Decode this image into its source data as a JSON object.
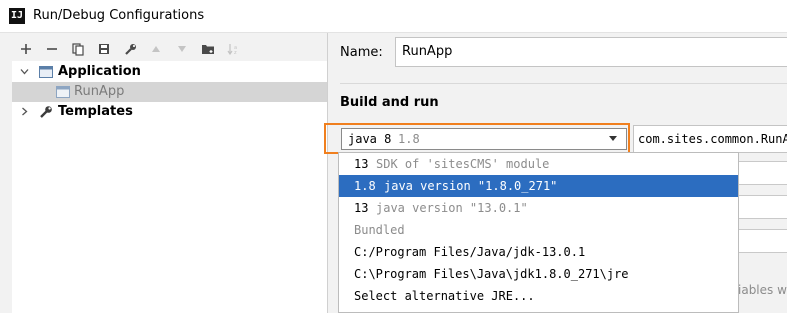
{
  "window": {
    "title": "Run/Debug Configurations",
    "app_icon_text": "IJ"
  },
  "toolbar": {
    "icons": [
      "plus-icon",
      "minus-icon",
      "copy-icon",
      "save-icon",
      "wrench-icon",
      "arrow-up-icon",
      "arrow-down-icon",
      "folder-icon",
      "sort-icon"
    ]
  },
  "tree": {
    "application_label": "Application",
    "runapp_label": "RunApp",
    "templates_label": "Templates"
  },
  "config": {
    "name_label": "Name:",
    "name_value": "RunApp",
    "build_run_label": "Build and run"
  },
  "jre_combo": {
    "primary": "java 8",
    "secondary": "1.8"
  },
  "main_class": {
    "value": "com.sites.common.RunApp"
  },
  "env_truncated": "iables w",
  "dropdown": {
    "items": [
      {
        "primary": "13",
        "secondary": "SDK of 'sitesCMS' module",
        "selected": false
      },
      {
        "primary": "1.8",
        "secondary": "java version \"1.8.0_271\"",
        "selected": true
      },
      {
        "primary": "13",
        "secondary": "java version \"13.0.1\"",
        "selected": false
      },
      {
        "primary": "Bundled",
        "secondary": "",
        "selected": false
      },
      {
        "primary": "C:/Program Files/Java/jdk-13.0.1",
        "secondary": "",
        "selected": false
      },
      {
        "primary": "C:\\Program Files\\Java\\jdk1.8.0_271\\jre",
        "secondary": "",
        "selected": false
      },
      {
        "primary": "Select alternative JRE...",
        "secondary": "",
        "selected": false
      }
    ]
  },
  "colors": {
    "highlight_border": "#f07f1e",
    "selection_blue": "#2c6dc0",
    "tree_selection": "#d5d5d5"
  }
}
